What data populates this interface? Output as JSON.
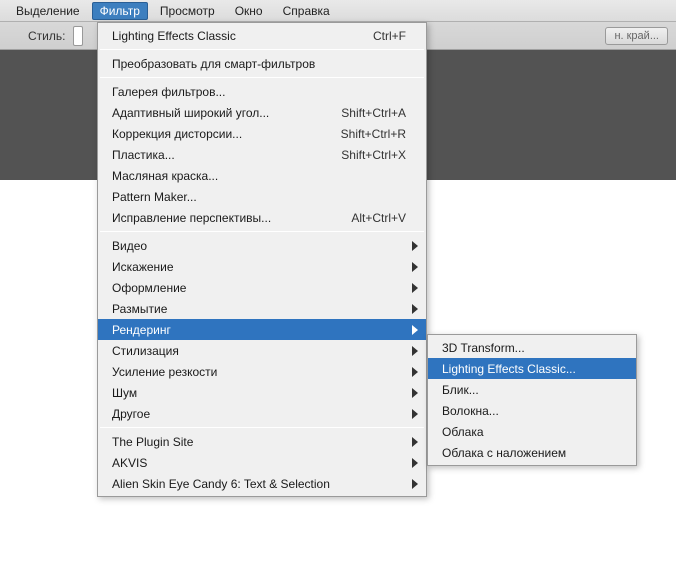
{
  "menubar": {
    "items": [
      "Выделение",
      "Фильтр",
      "Просмотр",
      "Окно",
      "Справка"
    ],
    "activeIndex": 1
  },
  "toolbar": {
    "style_label": "Стиль:",
    "btn_crop": "н. край..."
  },
  "dropdown": {
    "recent": {
      "label": "Lighting Effects Classic",
      "shortcut": "Ctrl+F"
    },
    "convert": "Преобразовать для смарт-фильтров",
    "group2": [
      {
        "label": "Галерея фильтров...",
        "shortcut": ""
      },
      {
        "label": "Адаптивный широкий угол...",
        "shortcut": "Shift+Ctrl+A"
      },
      {
        "label": "Коррекция дисторсии...",
        "shortcut": "Shift+Ctrl+R"
      },
      {
        "label": "Пластика...",
        "shortcut": "Shift+Ctrl+X"
      },
      {
        "label": "Масляная краска...",
        "shortcut": ""
      },
      {
        "label": "Pattern Maker...",
        "shortcut": ""
      },
      {
        "label": "Исправление перспективы...",
        "shortcut": "Alt+Ctrl+V"
      }
    ],
    "group3": [
      {
        "label": "Видео",
        "submenu": true
      },
      {
        "label": "Искажение",
        "submenu": true
      },
      {
        "label": "Оформление",
        "submenu": true
      },
      {
        "label": "Размытие",
        "submenu": true
      },
      {
        "label": "Рендеринг",
        "submenu": true,
        "highlight": true
      },
      {
        "label": "Стилизация",
        "submenu": true
      },
      {
        "label": "Усиление резкости",
        "submenu": true
      },
      {
        "label": "Шум",
        "submenu": true
      },
      {
        "label": "Другое",
        "submenu": true
      }
    ],
    "group4": [
      {
        "label": "The Plugin Site",
        "submenu": true
      },
      {
        "label": "AKVIS",
        "submenu": true
      },
      {
        "label": "Alien Skin Eye Candy 6: Text & Selection",
        "submenu": true
      }
    ]
  },
  "submenu": {
    "items": [
      {
        "label": "3D Transform..."
      },
      {
        "label": "Lighting Effects Classic...",
        "highlight": true
      },
      {
        "label": "Блик..."
      },
      {
        "label": "Волокна..."
      },
      {
        "label": "Облака"
      },
      {
        "label": "Облака с наложением"
      }
    ]
  }
}
